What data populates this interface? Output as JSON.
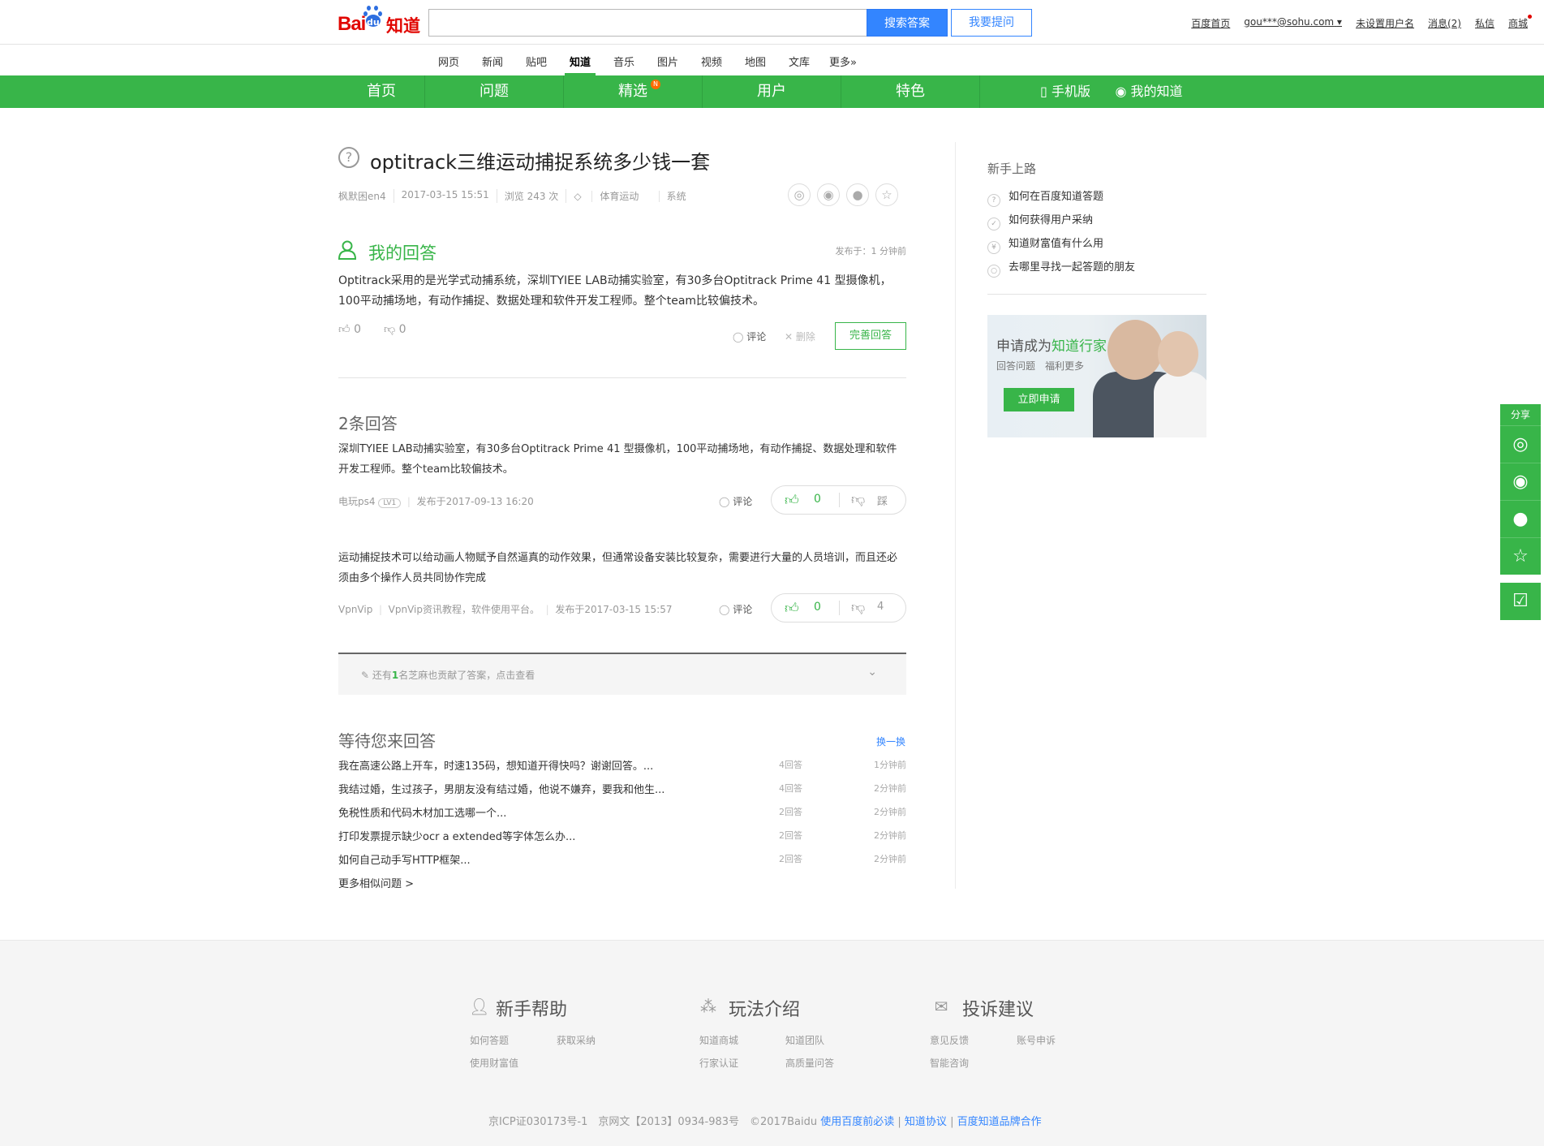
{
  "header": {
    "logo_bai": "Bai",
    "logo_du": "du",
    "logo_zhidao": "知道",
    "search_button": "搜索答案",
    "ask_button": "我要提问",
    "links": [
      "百度首页",
      "gou***@sohu.com",
      "未设置用户名",
      "消息(2)",
      "私信",
      "商城"
    ]
  },
  "channels": [
    "网页",
    "新闻",
    "贴吧",
    "知道",
    "音乐",
    "图片",
    "视频",
    "地图",
    "文库",
    "更多»"
  ],
  "nav": {
    "items": [
      "首页",
      "问题",
      "精选",
      "用户",
      "特色"
    ],
    "badge": "N",
    "mobile": "手机版",
    "mine": "我的知道"
  },
  "question": {
    "title": "optitrack三维运动捕捉系统多少钱一套",
    "author": "枫默困en4",
    "time": "2017-03-15 15:51",
    "views": "浏览 243 次",
    "tag1": "体育运动",
    "tag2": "系统"
  },
  "my_answer": {
    "title": "我的回答",
    "posted": "发布于：1 分钟前",
    "content": "Optitrack采用的是光学式动捕系统，深圳TYIEE LAB动捕实验室，有30多台Optitrack Prime 41 型摄像机，100平动捕场地，有动作捕捉、数据处理和软件开发工程师。整个team比较偏技术。",
    "up": "0",
    "down": "0",
    "comment": "评论",
    "delete": "删除",
    "perfect": "完善回答"
  },
  "answers": {
    "title": "2条回答",
    "list": [
      {
        "content": "深圳TYIEE LAB动捕实验室，有30多台Optitrack Prime 41 型摄像机，100平动捕场地，有动作捕捉、数据处理和软件开发工程师。整个team比较偏技术。",
        "user": "电玩ps4",
        "level": "LV1",
        "meta": "发布于2017-09-13 16:20",
        "comment": "评论",
        "up": "0",
        "down": "踩"
      },
      {
        "content": "运动捕捉技术可以给动画人物赋予自然逼真的动作效果，但通常设备安装比较复杂，需要进行大量的人员培训，而且还必须由多个操作人员共同协作完成",
        "user": "VpnVip",
        "level": "VpnVip资讯教程，软件使用平台。",
        "meta": "发布于2017-03-15 15:57",
        "comment": "评论",
        "up": "0",
        "down": "4"
      }
    ],
    "more_prefix": "还有",
    "more_count": "1",
    "more_suffix": "名芝麻也贡献了答案，点击查看"
  },
  "waiting": {
    "title": "等待您来回答",
    "refresh": "换一换",
    "items": [
      {
        "q": "我在高速公路上开车，时速135码，想知道开得快吗？谢谢回答。...",
        "c": "4回答",
        "t": "1分钟前"
      },
      {
        "q": "我结过婚，生过孩子，男朋友没有结过婚，他说不嫌弃，要我和他生...",
        "c": "4回答",
        "t": "2分钟前"
      },
      {
        "q": "免税性质和代码木材加工选哪一个...",
        "c": "2回答",
        "t": "2分钟前"
      },
      {
        "q": "打印发票提示缺少ocr a extended等字体怎么办...",
        "c": "2回答",
        "t": "2分钟前"
      },
      {
        "q": "如何自己动手写HTTP框架...",
        "c": "2回答",
        "t": "2分钟前"
      }
    ],
    "more": "更多相似问题 >"
  },
  "sidebar": {
    "title": "新手上路",
    "items": [
      "如何在百度知道答题",
      "如何获得用户采纳",
      "知道财富值有什么用",
      "去哪里寻找一起答题的朋友"
    ],
    "ad_prefix": "申请成为",
    "ad_highlight": "知道行家",
    "ad_sub": "回答问题　福利更多",
    "ad_button": "立即申请"
  },
  "float": {
    "share": "分享"
  },
  "footer": {
    "cols": [
      {
        "title": "新手帮助",
        "links": [
          "如何答题",
          "获取采纳",
          "使用财富值"
        ]
      },
      {
        "title": "玩法介绍",
        "links": [
          "知道商城",
          "知道团队",
          "行家认证",
          "高质量问答"
        ]
      },
      {
        "title": "投诉建议",
        "links": [
          "意见反馈",
          "账号申诉",
          "智能咨询"
        ]
      }
    ],
    "icp": "京ICP证030173号-1　京网文【2013】0934-983号　©2017Baidu",
    "links": [
      "使用百度前必读",
      "知道协议",
      "百度知道品牌合作"
    ]
  },
  "colors": {
    "green": "#38b549",
    "blue": "#3385ff",
    "red": "#e10601"
  }
}
